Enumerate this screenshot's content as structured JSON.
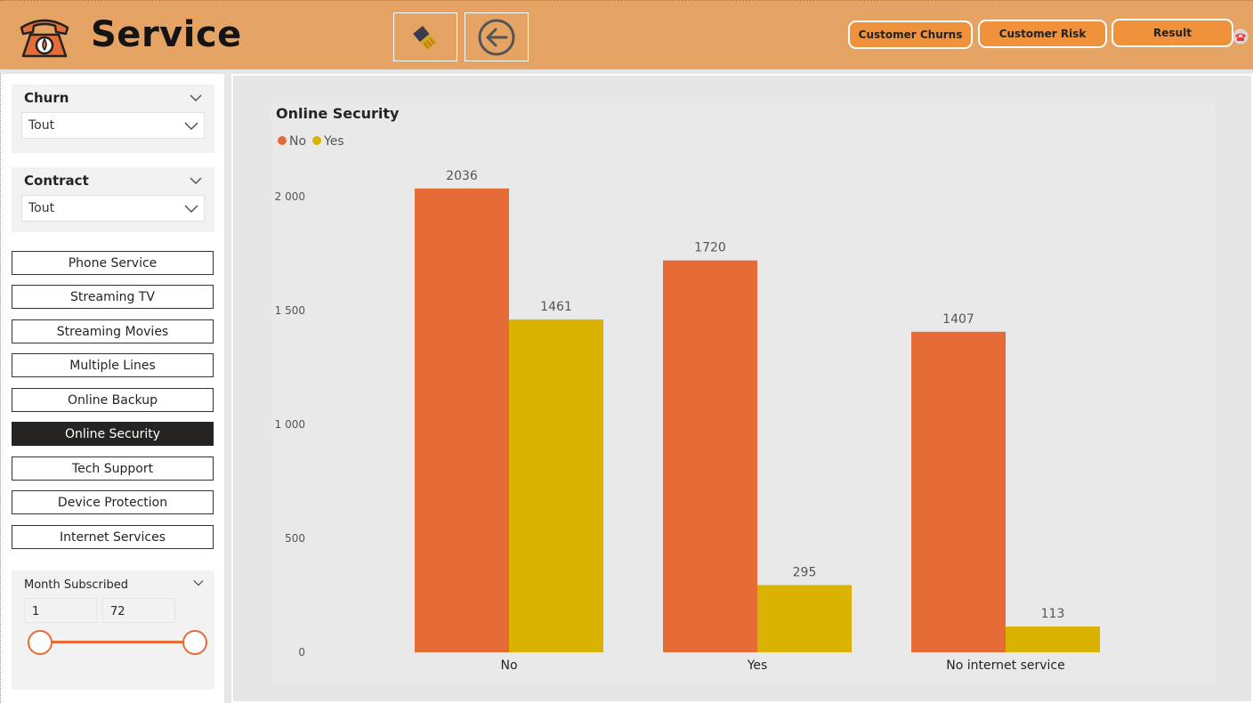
{
  "header": {
    "title": "Service",
    "nav_buttons": [
      "Customer Churns",
      "Customer Risk",
      "Result"
    ]
  },
  "icons": {
    "logo": "phone-icon",
    "clear": "eraser-icon",
    "back": "back-arrow-icon",
    "mini": "phone-mini-icon"
  },
  "colors": {
    "header": "#e5a464",
    "nav_button": "#f0913c",
    "series_no": "#e66c37",
    "series_yes": "#d9b300",
    "active_button": "#252423"
  },
  "filters": {
    "churn": {
      "title": "Churn",
      "value": "Tout"
    },
    "contract": {
      "title": "Contract",
      "value": "Tout"
    }
  },
  "service_buttons": [
    "Phone Service",
    "Streaming TV",
    "Streaming Movies",
    "Multiple Lines",
    "Online Backup",
    "Online Security",
    "Tech Support",
    "Device Protection",
    "Internet Services"
  ],
  "active_service": "Online Security",
  "month_slicer": {
    "title": "Month Subscribed",
    "min": "1",
    "max": "72"
  },
  "chart_data": {
    "type": "bar",
    "title": "Online Security",
    "categories": [
      "No",
      "Yes",
      "No internet service"
    ],
    "series": [
      {
        "name": "No",
        "values": [
          2036,
          1720,
          1407
        ]
      },
      {
        "name": "Yes",
        "values": [
          1461,
          295,
          113
        ]
      }
    ],
    "yticks": [
      "0",
      "500",
      "1 000",
      "1 500",
      "2 000"
    ],
    "ylim": [
      0,
      2300
    ],
    "legend_position": "top-left",
    "grid": false
  }
}
